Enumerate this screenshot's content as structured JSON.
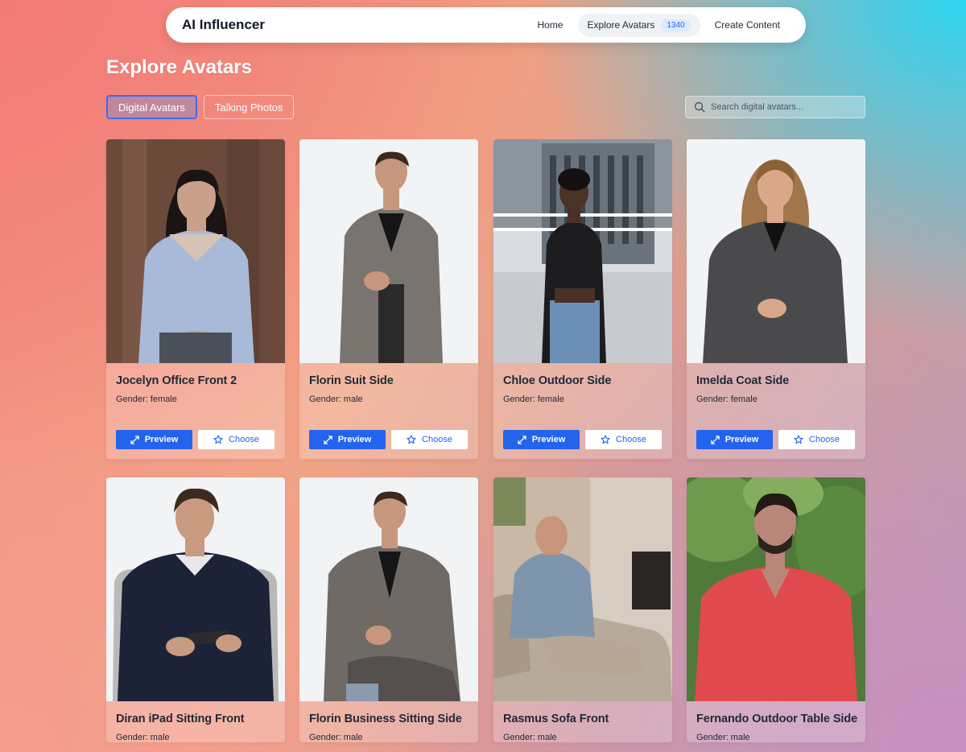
{
  "nav": {
    "brand": "AI Influencer",
    "links": [
      {
        "label": "Home"
      },
      {
        "label": "Explore Avatars",
        "count": "1340"
      },
      {
        "label": "Create Content"
      }
    ]
  },
  "page_title": "Explore Avatars",
  "tabs": [
    {
      "label": "Digital Avatars",
      "active": true
    },
    {
      "label": "Talking Photos",
      "active": false
    }
  ],
  "search": {
    "placeholder": "Search digital avatars...",
    "value": ""
  },
  "buttons": {
    "preview": "Preview",
    "choose": "Choose"
  },
  "colors": {
    "accent": "#2463eb",
    "badge_bg": "#dbeafe"
  },
  "avatars": [
    {
      "name": "Jocelyn Office Front 2",
      "gender": "Gender: female"
    },
    {
      "name": "Florin Suit Side",
      "gender": "Gender: male"
    },
    {
      "name": "Chloe Outdoor Side",
      "gender": "Gender: female"
    },
    {
      "name": "Imelda Coat Side",
      "gender": "Gender: female"
    },
    {
      "name": "Diran iPad Sitting Front",
      "gender": "Gender: male"
    },
    {
      "name": "Florin Business Sitting Side",
      "gender": "Gender: male"
    },
    {
      "name": "Rasmus Sofa Front",
      "gender": "Gender: male"
    },
    {
      "name": "Fernando Outdoor Table Side",
      "gender": "Gender: male"
    }
  ]
}
